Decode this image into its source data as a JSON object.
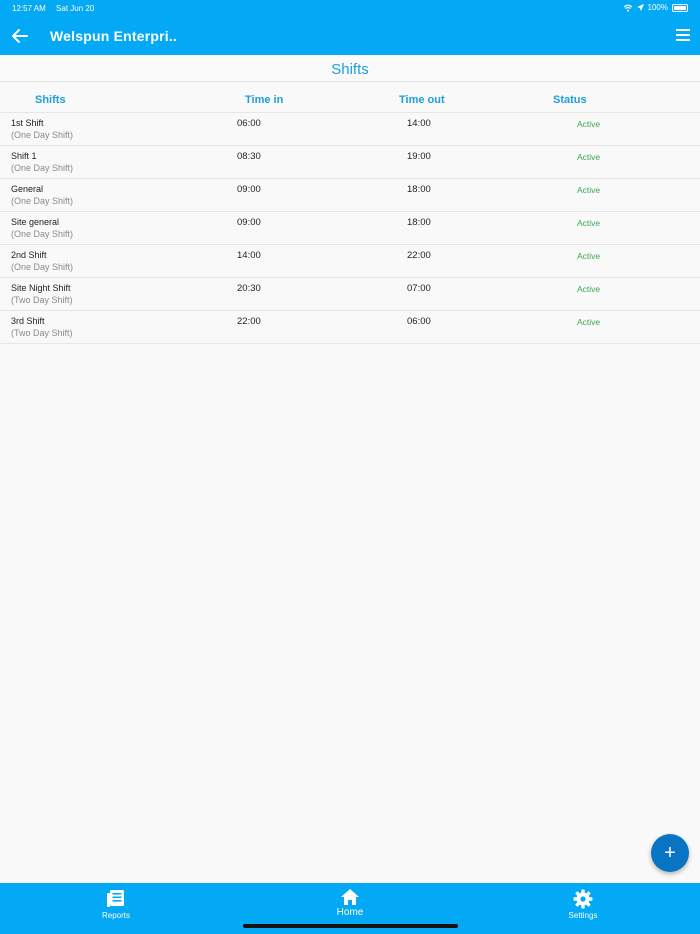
{
  "status_bar": {
    "time": "12:57 AM",
    "date": "Sat Jun 20",
    "battery": "100%"
  },
  "header": {
    "title": "Welspun Enterpri.."
  },
  "page": {
    "heading": "Shifts"
  },
  "columns": {
    "shifts": "Shifts",
    "time_in": "Time in",
    "time_out": "Time out",
    "status": "Status"
  },
  "rows": [
    {
      "name": "1st Shift",
      "type": "(One Day Shift)",
      "time_in": "06:00",
      "time_out": "14:00",
      "status": "Active"
    },
    {
      "name": "Shift 1",
      "type": "(One Day Shift)",
      "time_in": "08:30",
      "time_out": "19:00",
      "status": "Active"
    },
    {
      "name": "General",
      "type": "(One Day Shift)",
      "time_in": "09:00",
      "time_out": "18:00",
      "status": "Active"
    },
    {
      "name": "Site general",
      "type": "(One Day Shift)",
      "time_in": "09:00",
      "time_out": "18:00",
      "status": "Active"
    },
    {
      "name": "2nd Shift",
      "type": "(One Day Shift)",
      "time_in": "14:00",
      "time_out": "22:00",
      "status": "Active"
    },
    {
      "name": "Site Night Shift",
      "type": "(Two Day Shift)",
      "time_in": "20:30",
      "time_out": "07:00",
      "status": "Active"
    },
    {
      "name": "3rd Shift",
      "type": "(Two Day Shift)",
      "time_in": "22:00",
      "time_out": "06:00",
      "status": "Active"
    }
  ],
  "fab": {
    "label": "+"
  },
  "bottom_nav": {
    "reports": "Reports",
    "home": "Home",
    "settings": "Settings"
  },
  "colors": {
    "primary": "#03a9f4",
    "accent_text": "#1e9fdb",
    "active_status": "#3aa655",
    "fab": "#0a74c4"
  },
  "icons": {
    "back": "arrow-left-icon",
    "menu": "hamburger-menu-icon",
    "reports": "newspaper-icon",
    "home": "home-icon",
    "settings": "gear-icon",
    "wifi": "wifi-icon",
    "location": "location-arrow-icon",
    "battery": "battery-icon"
  }
}
